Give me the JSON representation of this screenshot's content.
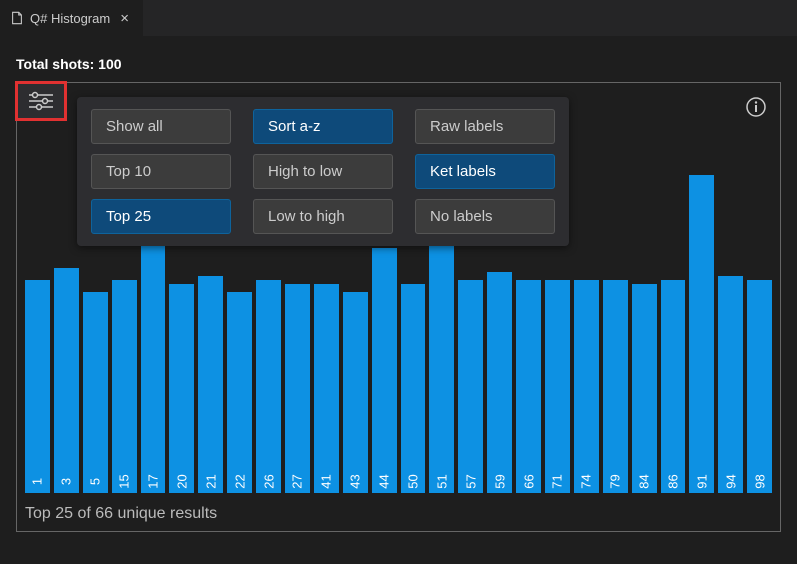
{
  "tab": {
    "title": "Q# Histogram"
  },
  "total_shots_label": "Total shots: 100",
  "options": {
    "filter": [
      {
        "label": "Show all",
        "active": false
      },
      {
        "label": "Top 10",
        "active": false
      },
      {
        "label": "Top 25",
        "active": true
      }
    ],
    "sort": [
      {
        "label": "Sort a-z",
        "active": true
      },
      {
        "label": "High to low",
        "active": false
      },
      {
        "label": "Low to high",
        "active": false
      }
    ],
    "labels": [
      {
        "label": "Raw labels",
        "active": false
      },
      {
        "label": "Ket labels",
        "active": true
      },
      {
        "label": "No labels",
        "active": false
      }
    ]
  },
  "footer": "Top 25 of 66 unique results",
  "chart_data": {
    "type": "bar",
    "title": "",
    "xlabel": "",
    "ylabel": "",
    "ylim": [
      0,
      100
    ],
    "categories": [
      "1",
      "3",
      "5",
      "15",
      "17",
      "20",
      "21",
      "22",
      "26",
      "27",
      "41",
      "43",
      "44",
      "50",
      "51",
      "57",
      "59",
      "66",
      "71",
      "74",
      "79",
      "84",
      "86",
      "91",
      "94",
      "98"
    ],
    "values": [
      53,
      56,
      50,
      53,
      62,
      52,
      54,
      50,
      53,
      52,
      52,
      50,
      61,
      52,
      64,
      53,
      55,
      53,
      53,
      53,
      53,
      52,
      53,
      79,
      54,
      53
    ]
  }
}
